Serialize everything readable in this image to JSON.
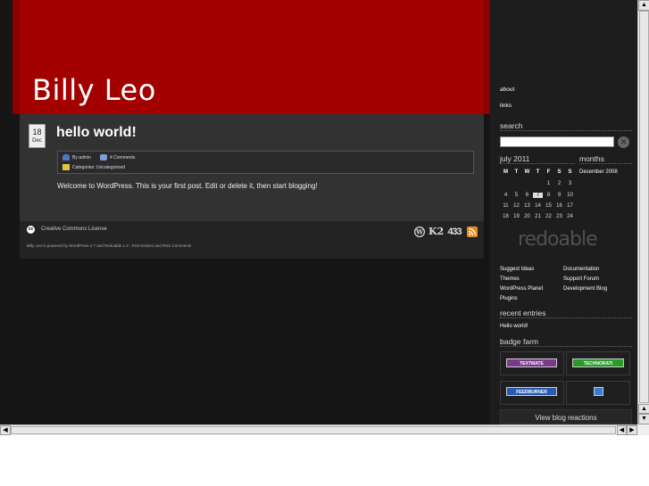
{
  "header": {
    "site_title": "Billy Leo"
  },
  "post": {
    "date_day": "18",
    "date_month": "Dec",
    "title": "hello world!",
    "author_label": "By admin",
    "comments_label": "4 Comments",
    "categories_label": "Categories: Uncategorized",
    "body": "Welcome to WordPress. This is your first post. Edit or delete it, then start blogging!"
  },
  "footer": {
    "cc_label": "Creative Commons License",
    "powered_by": "Billy Leo is powered by WordPress 2.7 and Redoable 1.2 : RSS Entries and RSS Comments",
    "icons": [
      "wordpress-icon",
      "k2-icon",
      "w3c-icon",
      "rss-icon"
    ],
    "k2_text": "K2",
    "w3c_text": "433"
  },
  "sidebar": {
    "pages": [
      "about",
      "links"
    ],
    "search_heading": "search",
    "search_placeholder": "",
    "calendar": {
      "heading": "july 2011",
      "weekdays": [
        "M",
        "T",
        "W",
        "T",
        "F",
        "S",
        "S"
      ],
      "weeks": [
        [
          "",
          "",
          "",
          "",
          "1",
          "2",
          "3"
        ],
        [
          "4",
          "5",
          "6",
          "7",
          "8",
          "9",
          "10"
        ],
        [
          "11",
          "12",
          "13",
          "14",
          "15",
          "16",
          "17"
        ],
        [
          "18",
          "19",
          "20",
          "21",
          "22",
          "23",
          "24"
        ]
      ],
      "today": "7"
    },
    "months_heading": "months",
    "months": [
      "December 2008"
    ],
    "logo_text": "redoable",
    "links_left": [
      "Suggest Ideas",
      "Themes",
      "WordPress Planet",
      "Plugins"
    ],
    "links_right": [
      "Documentation",
      "Support Forum",
      "Development Blog"
    ],
    "recent_heading": "recent entries",
    "recent": [
      "Hello world!"
    ],
    "badge_heading": "badge farm",
    "badges": [
      "TEXTMATE",
      "TECHNORATI",
      "FEEDBURNER",
      ""
    ],
    "reactions_label": "View blog reactions"
  },
  "colors": {
    "header_red": "#a30000",
    "header_dark_red": "#8c0000",
    "background": "#151515"
  }
}
